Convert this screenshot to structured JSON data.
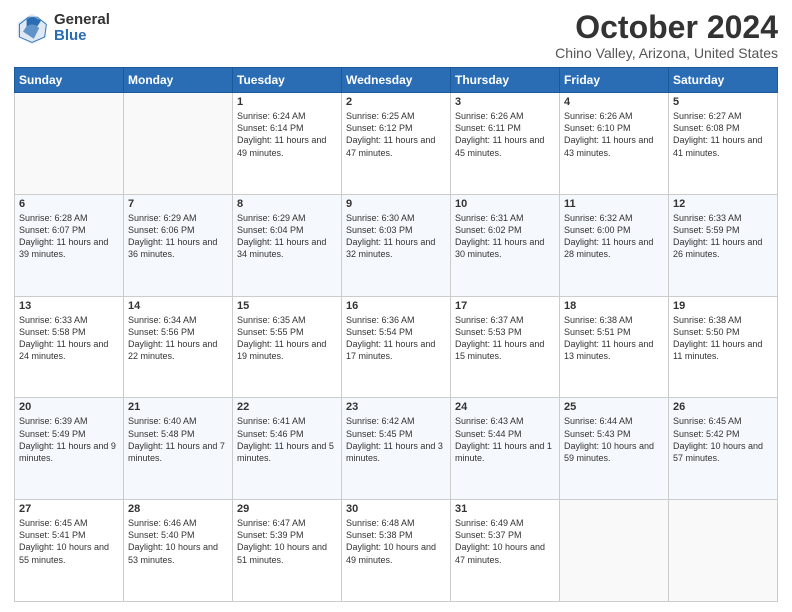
{
  "logo": {
    "general": "General",
    "blue": "Blue"
  },
  "header": {
    "title": "October 2024",
    "subtitle": "Chino Valley, Arizona, United States"
  },
  "weekdays": [
    "Sunday",
    "Monday",
    "Tuesday",
    "Wednesday",
    "Thursday",
    "Friday",
    "Saturday"
  ],
  "weeks": [
    [
      {
        "day": "",
        "info": ""
      },
      {
        "day": "",
        "info": ""
      },
      {
        "day": "1",
        "info": "Sunrise: 6:24 AM\nSunset: 6:14 PM\nDaylight: 11 hours and 49 minutes."
      },
      {
        "day": "2",
        "info": "Sunrise: 6:25 AM\nSunset: 6:12 PM\nDaylight: 11 hours and 47 minutes."
      },
      {
        "day": "3",
        "info": "Sunrise: 6:26 AM\nSunset: 6:11 PM\nDaylight: 11 hours and 45 minutes."
      },
      {
        "day": "4",
        "info": "Sunrise: 6:26 AM\nSunset: 6:10 PM\nDaylight: 11 hours and 43 minutes."
      },
      {
        "day": "5",
        "info": "Sunrise: 6:27 AM\nSunset: 6:08 PM\nDaylight: 11 hours and 41 minutes."
      }
    ],
    [
      {
        "day": "6",
        "info": "Sunrise: 6:28 AM\nSunset: 6:07 PM\nDaylight: 11 hours and 39 minutes."
      },
      {
        "day": "7",
        "info": "Sunrise: 6:29 AM\nSunset: 6:06 PM\nDaylight: 11 hours and 36 minutes."
      },
      {
        "day": "8",
        "info": "Sunrise: 6:29 AM\nSunset: 6:04 PM\nDaylight: 11 hours and 34 minutes."
      },
      {
        "day": "9",
        "info": "Sunrise: 6:30 AM\nSunset: 6:03 PM\nDaylight: 11 hours and 32 minutes."
      },
      {
        "day": "10",
        "info": "Sunrise: 6:31 AM\nSunset: 6:02 PM\nDaylight: 11 hours and 30 minutes."
      },
      {
        "day": "11",
        "info": "Sunrise: 6:32 AM\nSunset: 6:00 PM\nDaylight: 11 hours and 28 minutes."
      },
      {
        "day": "12",
        "info": "Sunrise: 6:33 AM\nSunset: 5:59 PM\nDaylight: 11 hours and 26 minutes."
      }
    ],
    [
      {
        "day": "13",
        "info": "Sunrise: 6:33 AM\nSunset: 5:58 PM\nDaylight: 11 hours and 24 minutes."
      },
      {
        "day": "14",
        "info": "Sunrise: 6:34 AM\nSunset: 5:56 PM\nDaylight: 11 hours and 22 minutes."
      },
      {
        "day": "15",
        "info": "Sunrise: 6:35 AM\nSunset: 5:55 PM\nDaylight: 11 hours and 19 minutes."
      },
      {
        "day": "16",
        "info": "Sunrise: 6:36 AM\nSunset: 5:54 PM\nDaylight: 11 hours and 17 minutes."
      },
      {
        "day": "17",
        "info": "Sunrise: 6:37 AM\nSunset: 5:53 PM\nDaylight: 11 hours and 15 minutes."
      },
      {
        "day": "18",
        "info": "Sunrise: 6:38 AM\nSunset: 5:51 PM\nDaylight: 11 hours and 13 minutes."
      },
      {
        "day": "19",
        "info": "Sunrise: 6:38 AM\nSunset: 5:50 PM\nDaylight: 11 hours and 11 minutes."
      }
    ],
    [
      {
        "day": "20",
        "info": "Sunrise: 6:39 AM\nSunset: 5:49 PM\nDaylight: 11 hours and 9 minutes."
      },
      {
        "day": "21",
        "info": "Sunrise: 6:40 AM\nSunset: 5:48 PM\nDaylight: 11 hours and 7 minutes."
      },
      {
        "day": "22",
        "info": "Sunrise: 6:41 AM\nSunset: 5:46 PM\nDaylight: 11 hours and 5 minutes."
      },
      {
        "day": "23",
        "info": "Sunrise: 6:42 AM\nSunset: 5:45 PM\nDaylight: 11 hours and 3 minutes."
      },
      {
        "day": "24",
        "info": "Sunrise: 6:43 AM\nSunset: 5:44 PM\nDaylight: 11 hours and 1 minute."
      },
      {
        "day": "25",
        "info": "Sunrise: 6:44 AM\nSunset: 5:43 PM\nDaylight: 10 hours and 59 minutes."
      },
      {
        "day": "26",
        "info": "Sunrise: 6:45 AM\nSunset: 5:42 PM\nDaylight: 10 hours and 57 minutes."
      }
    ],
    [
      {
        "day": "27",
        "info": "Sunrise: 6:45 AM\nSunset: 5:41 PM\nDaylight: 10 hours and 55 minutes."
      },
      {
        "day": "28",
        "info": "Sunrise: 6:46 AM\nSunset: 5:40 PM\nDaylight: 10 hours and 53 minutes."
      },
      {
        "day": "29",
        "info": "Sunrise: 6:47 AM\nSunset: 5:39 PM\nDaylight: 10 hours and 51 minutes."
      },
      {
        "day": "30",
        "info": "Sunrise: 6:48 AM\nSunset: 5:38 PM\nDaylight: 10 hours and 49 minutes."
      },
      {
        "day": "31",
        "info": "Sunrise: 6:49 AM\nSunset: 5:37 PM\nDaylight: 10 hours and 47 minutes."
      },
      {
        "day": "",
        "info": ""
      },
      {
        "day": "",
        "info": ""
      }
    ]
  ]
}
